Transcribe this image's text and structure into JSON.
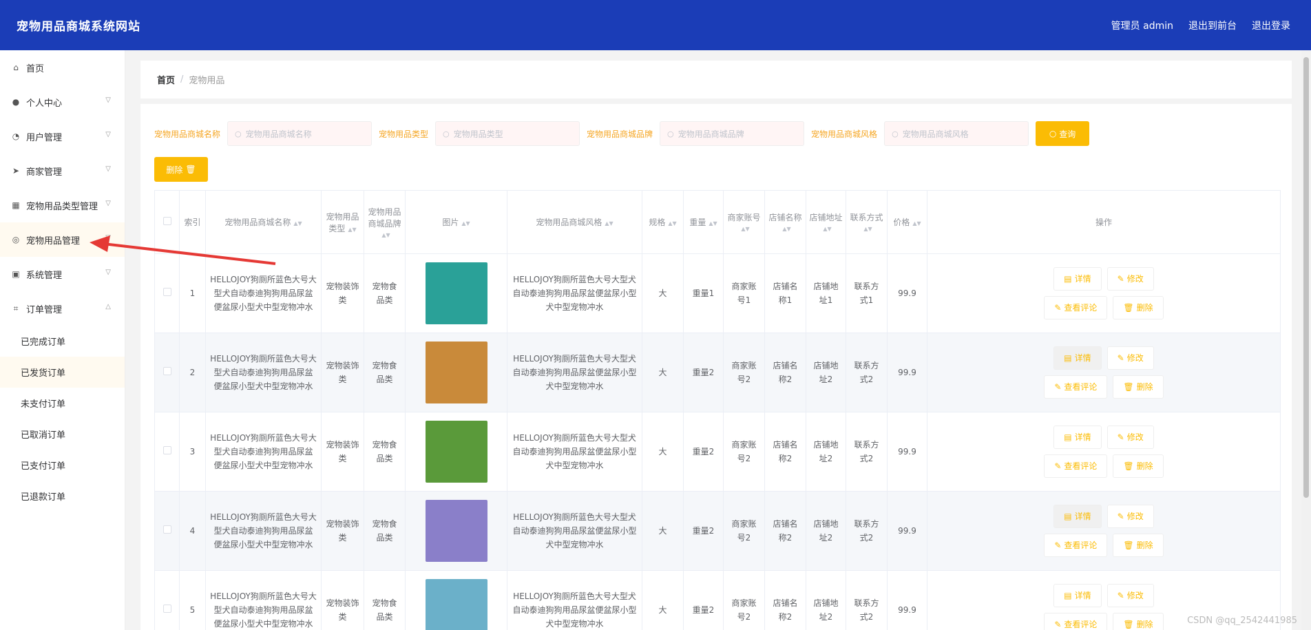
{
  "header": {
    "title": "宠物用品商城系统网站",
    "admin": "管理员 admin",
    "front": "退出到前台",
    "logout": "退出登录"
  },
  "sidebar": {
    "items": [
      {
        "label": "首页",
        "icon": "home-icon"
      },
      {
        "label": "个人中心",
        "icon": "user-icon"
      },
      {
        "label": "用户管理",
        "icon": "speedometer-icon"
      },
      {
        "label": "商家管理",
        "icon": "send-icon"
      },
      {
        "label": "宠物用品类型管理",
        "icon": "grid-icon"
      },
      {
        "label": "宠物用品管理",
        "icon": "target-icon"
      },
      {
        "label": "系统管理",
        "icon": "briefcase-icon"
      },
      {
        "label": "订单管理",
        "icon": "crop-icon"
      }
    ],
    "sub_items": [
      "已完成订单",
      "已发货订单",
      "未支付订单",
      "已取消订单",
      "已支付订单",
      "已退款订单"
    ]
  },
  "breadcrumb": {
    "home": "首页",
    "sep": "/",
    "current": "宠物用品"
  },
  "search": {
    "fields": [
      {
        "label": "宠物用品商城名称",
        "placeholder": "宠物用品商城名称"
      },
      {
        "label": "宠物用品类型",
        "placeholder": "宠物用品类型"
      },
      {
        "label": "宠物用品商城品牌",
        "placeholder": "宠物用品商城品牌"
      },
      {
        "label": "宠物用品商城风格",
        "placeholder": "宠物用品商城风格"
      }
    ],
    "query": "查询",
    "delete": "删除"
  },
  "table": {
    "headers": [
      "索引",
      "宠物用品商城名称",
      "宠物用品类型",
      "宠物用品商城品牌",
      "图片",
      "宠物用品商城风格",
      "规格",
      "重量",
      "商家账号",
      "店铺名称",
      "店铺地址",
      "联系方式",
      "价格",
      "操作"
    ],
    "rows": [
      {
        "idx": "1",
        "name": "HELLOJOY狗厕所蓝色大号大型犬自动泰迪狗狗用品尿盆便盆尿小型犬中型宠物冲水",
        "type": "宠物装饰类",
        "brand": "宠物食品类",
        "style": "HELLOJOY狗厕所蓝色大号大型犬自动泰迪狗狗用品尿盆便盆尿小型犬中型宠物冲水",
        "spec": "大",
        "weight": "重量1",
        "acct": "商家账号1",
        "shop": "店铺名称1",
        "addr": "店铺地址1",
        "contact": "联系方式1",
        "price": "99.9",
        "img_color": "#2aa198"
      },
      {
        "idx": "2",
        "name": "HELLOJOY狗厕所蓝色大号大型犬自动泰迪狗狗用品尿盆便盆尿小型犬中型宠物冲水",
        "type": "宠物装饰类",
        "brand": "宠物食品类",
        "style": "HELLOJOY狗厕所蓝色大号大型犬自动泰迪狗狗用品尿盆便盆尿小型犬中型宠物冲水",
        "spec": "大",
        "weight": "重量2",
        "acct": "商家账号2",
        "shop": "店铺名称2",
        "addr": "店铺地址2",
        "contact": "联系方式2",
        "price": "99.9",
        "img_color": "#c98a3a"
      },
      {
        "idx": "3",
        "name": "HELLOJOY狗厕所蓝色大号大型犬自动泰迪狗狗用品尿盆便盆尿小型犬中型宠物冲水",
        "type": "宠物装饰类",
        "brand": "宠物食品类",
        "style": "HELLOJOY狗厕所蓝色大号大型犬自动泰迪狗狗用品尿盆便盆尿小型犬中型宠物冲水",
        "spec": "大",
        "weight": "重量2",
        "acct": "商家账号2",
        "shop": "店铺名称2",
        "addr": "店铺地址2",
        "contact": "联系方式2",
        "price": "99.9",
        "img_color": "#5a9a3a"
      },
      {
        "idx": "4",
        "name": "HELLOJOY狗厕所蓝色大号大型犬自动泰迪狗狗用品尿盆便盆尿小型犬中型宠物冲水",
        "type": "宠物装饰类",
        "brand": "宠物食品类",
        "style": "HELLOJOY狗厕所蓝色大号大型犬自动泰迪狗狗用品尿盆便盆尿小型犬中型宠物冲水",
        "spec": "大",
        "weight": "重量2",
        "acct": "商家账号2",
        "shop": "店铺名称2",
        "addr": "店铺地址2",
        "contact": "联系方式2",
        "price": "99.9",
        "img_color": "#8a7fc9"
      },
      {
        "idx": "5",
        "name": "HELLOJOY狗厕所蓝色大号大型犬自动泰迪狗狗用品尿盆便盆尿小型犬中型宠物冲水",
        "type": "宠物装饰类",
        "brand": "宠物食品类",
        "style": "HELLOJOY狗厕所蓝色大号大型犬自动泰迪狗狗用品尿盆便盆尿小型犬中型宠物冲水",
        "spec": "大",
        "weight": "重量2",
        "acct": "商家账号2",
        "shop": "店铺名称2",
        "addr": "店铺地址2",
        "contact": "联系方式2",
        "price": "99.9",
        "img_color": "#6bb0c9"
      }
    ],
    "ops": {
      "detail": "详情",
      "edit": "修改",
      "comments": "查看评论",
      "delete": "删除"
    }
  },
  "watermark": "CSDN @qq_2542441985",
  "colors": {
    "header": "#1b3db7",
    "accent": "#fbbc05",
    "arrow": "#e53935"
  }
}
